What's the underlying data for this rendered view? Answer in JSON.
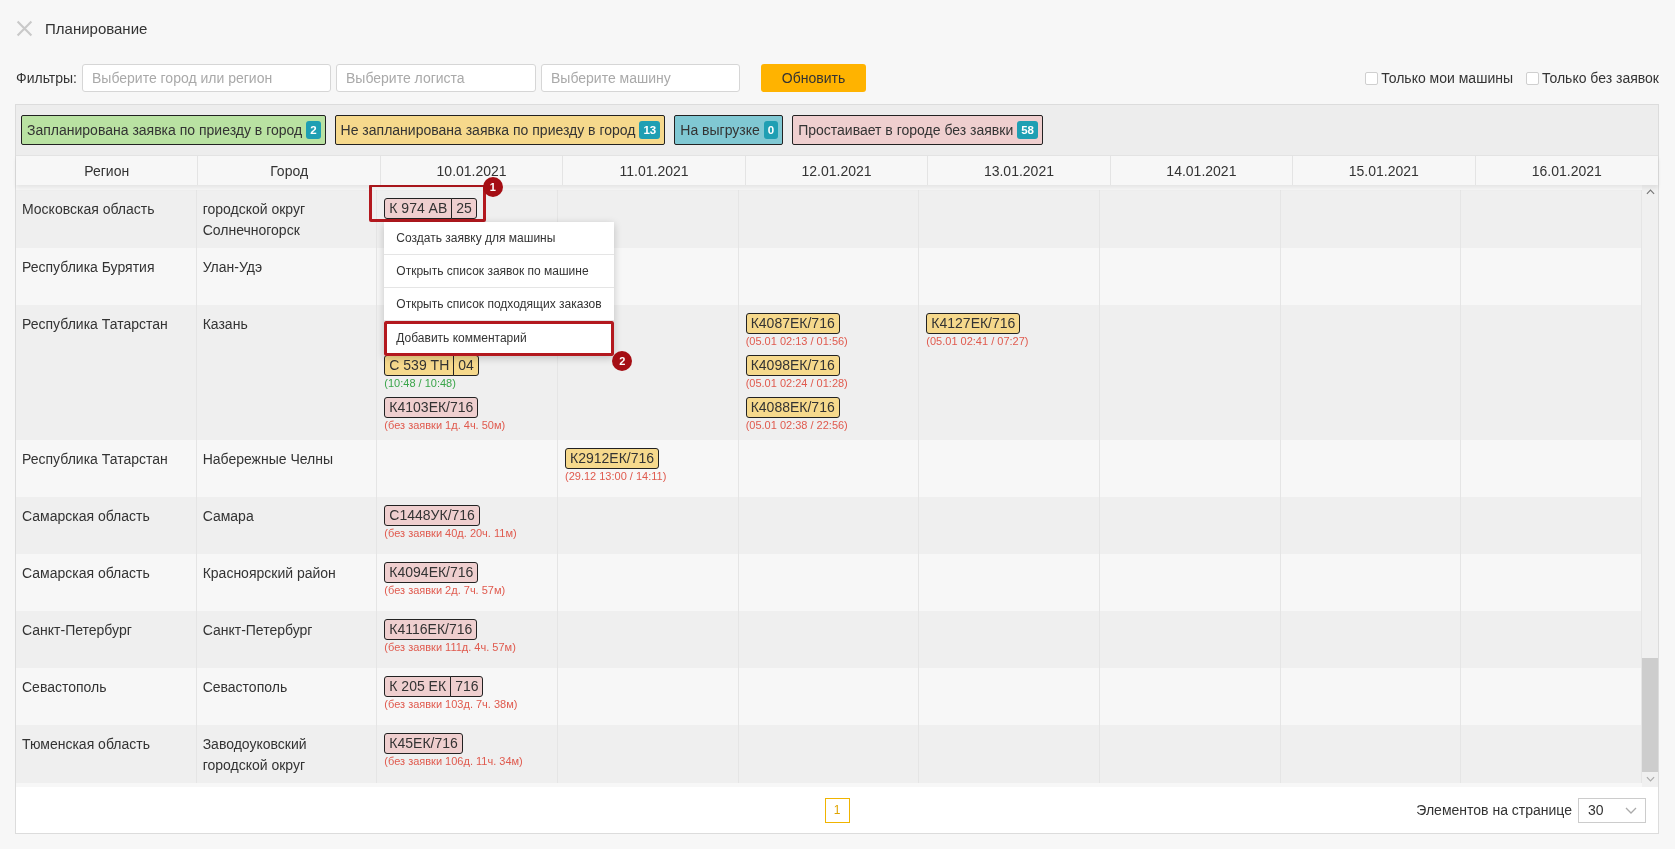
{
  "page": {
    "title": "Планирование"
  },
  "filters": {
    "label": "Фильтры:",
    "fields": [
      {
        "placeholder": "Выберите город или регион"
      },
      {
        "placeholder": "Выберите логиста"
      },
      {
        "placeholder": "Выберите машину"
      }
    ],
    "button": "Обновить",
    "checkboxes": [
      {
        "label": "Только мои машины",
        "checked": false
      },
      {
        "label": "Только без заявок",
        "checked": false
      }
    ]
  },
  "legend": [
    {
      "label": "Запланирована заявка по приезду в город",
      "count": "2",
      "color": "#b9e2a2"
    },
    {
      "label": "Не запланирована заявка по приезду в город",
      "count": "13",
      "color": "#f6d98c"
    },
    {
      "label": "На выгрузке",
      "count": "0",
      "color": "#80c8d3"
    },
    {
      "label": "Простаивает в городе без заявки",
      "count": "58",
      "color": "#efcfcf"
    }
  ],
  "table": {
    "columns": [
      "Регион",
      "Город",
      "10.01.2021",
      "11.01.2021",
      "12.01.2021",
      "13.01.2021",
      "14.01.2021",
      "15.01.2021",
      "16.01.2021"
    ],
    "rows": [
      {
        "cells": [
          {
            "text": "Московская область"
          },
          {
            "text": "городской округ Солнечногорск"
          },
          {
            "trucks": [
              {
                "plate": [
                  "К 974 АВ",
                  "25"
                ],
                "color": "#efcfcf",
                "callout": "1",
                "context_menu": {
                  "items": [
                    {
                      "label": "Создать заявку для машины"
                    },
                    {
                      "label": "Открыть список заявок по машине"
                    },
                    {
                      "label": "Открыть список подходящих заказов"
                    },
                    {
                      "label": "Добавить комментарий",
                      "callout": "2"
                    }
                  ]
                }
              }
            ]
          },
          {},
          {},
          {},
          {},
          {},
          {}
        ]
      },
      {
        "cells": [
          {
            "text": "Республика Бурятия"
          },
          {
            "text": "Улан-Удэ"
          },
          {},
          {},
          {},
          {},
          {},
          {},
          {}
        ]
      },
      {
        "cells": [
          {
            "text": "Республика Татарстан"
          },
          {
            "text": "Казань"
          },
          {
            "hidden_above": true,
            "trucks": [
              {
                "plate": [
                  "С 539 ТН",
                  "04"
                ],
                "color": "#f6d98c",
                "note": {
                  "text": "(10:48 / 10:48)",
                  "color": "#3aa54a"
                }
              },
              {
                "plate": [
                  "К4103ЕК/716"
                ],
                "color": "#efcfcf",
                "note": {
                  "text": "(без заявки 1д. 4ч. 50м)",
                  "color": "#e05a4e"
                }
              }
            ]
          },
          {},
          {
            "trucks": [
              {
                "plate": [
                  "К4087ЕК/716"
                ],
                "color": "#f6d98c",
                "note": {
                  "text": "(05.01 02:13 / 01:56)",
                  "color": "#e05a4e"
                }
              },
              {
                "plate": [
                  "К4098ЕК/716"
                ],
                "color": "#f6d98c",
                "note": {
                  "text": "(05.01 02:24 / 01:28)",
                  "color": "#e05a4e"
                }
              },
              {
                "plate": [
                  "К4088ЕК/716"
                ],
                "color": "#f6d98c",
                "note": {
                  "text": "(05.01 02:38 / 22:56)",
                  "color": "#e05a4e"
                }
              }
            ]
          },
          {
            "trucks": [
              {
                "plate": [
                  "К4127ЕК/716"
                ],
                "color": "#f6d98c",
                "note": {
                  "text": "(05.01 02:41 / 07:27)",
                  "color": "#e05a4e"
                }
              }
            ]
          },
          {},
          {},
          {}
        ]
      },
      {
        "cells": [
          {
            "text": "Республика Татарстан"
          },
          {
            "text": "Набережные Челны"
          },
          {},
          {
            "trucks": [
              {
                "plate": [
                  "К2912ЕК/716"
                ],
                "color": "#f6d98c",
                "note": {
                  "text": "(29.12 13:00 / 14:11)",
                  "color": "#e05a4e"
                }
              }
            ]
          },
          {},
          {},
          {},
          {},
          {}
        ]
      },
      {
        "cells": [
          {
            "text": "Самарская область"
          },
          {
            "text": "Самара"
          },
          {
            "trucks": [
              {
                "plate": [
                  "С1448УК/716"
                ],
                "color": "#efcfcf",
                "note": {
                  "text": "(без заявки 40д. 20ч. 11м)",
                  "color": "#e05a4e"
                }
              }
            ]
          },
          {},
          {},
          {},
          {},
          {},
          {}
        ]
      },
      {
        "cells": [
          {
            "text": "Самарская область"
          },
          {
            "text": "Красноярский район"
          },
          {
            "trucks": [
              {
                "plate": [
                  "К4094ЕК/716"
                ],
                "color": "#efcfcf",
                "note": {
                  "text": "(без заявки 2д. 7ч. 57м)",
                  "color": "#e05a4e"
                }
              }
            ]
          },
          {},
          {},
          {},
          {},
          {},
          {}
        ]
      },
      {
        "cells": [
          {
            "text": "Санкт-Петербург"
          },
          {
            "text": "Санкт-Петербург"
          },
          {
            "trucks": [
              {
                "plate": [
                  "К4116ЕК/716"
                ],
                "color": "#efcfcf",
                "note": {
                  "text": "(без заявки 111д. 4ч. 57м)",
                  "color": "#e05a4e"
                }
              }
            ]
          },
          {},
          {},
          {},
          {},
          {},
          {}
        ]
      },
      {
        "cells": [
          {
            "text": "Севастополь"
          },
          {
            "text": "Севастополь"
          },
          {
            "trucks": [
              {
                "plate": [
                  "К 205 ЕК",
                  "716"
                ],
                "color": "#efcfcf",
                "note": {
                  "text": "(без заявки 103д. 7ч. 38м)",
                  "color": "#e05a4e"
                }
              }
            ]
          },
          {},
          {},
          {},
          {},
          {},
          {}
        ]
      },
      {
        "cells": [
          {
            "text": "Тюменская область"
          },
          {
            "text": "Заводоуковский городской округ"
          },
          {
            "trucks": [
              {
                "plate": [
                  "К45ЕК/716"
                ],
                "color": "#efcfcf",
                "note": {
                  "text": "(без заявки 106д. 11ч. 34м)",
                  "color": "#e05a4e"
                }
              }
            ]
          },
          {},
          {},
          {},
          {},
          {},
          {}
        ]
      }
    ]
  },
  "pagination": {
    "pages": [
      {
        "label": "1",
        "selected": true
      }
    ],
    "page_size_label": "Элементов на странице",
    "page_size": "30"
  }
}
